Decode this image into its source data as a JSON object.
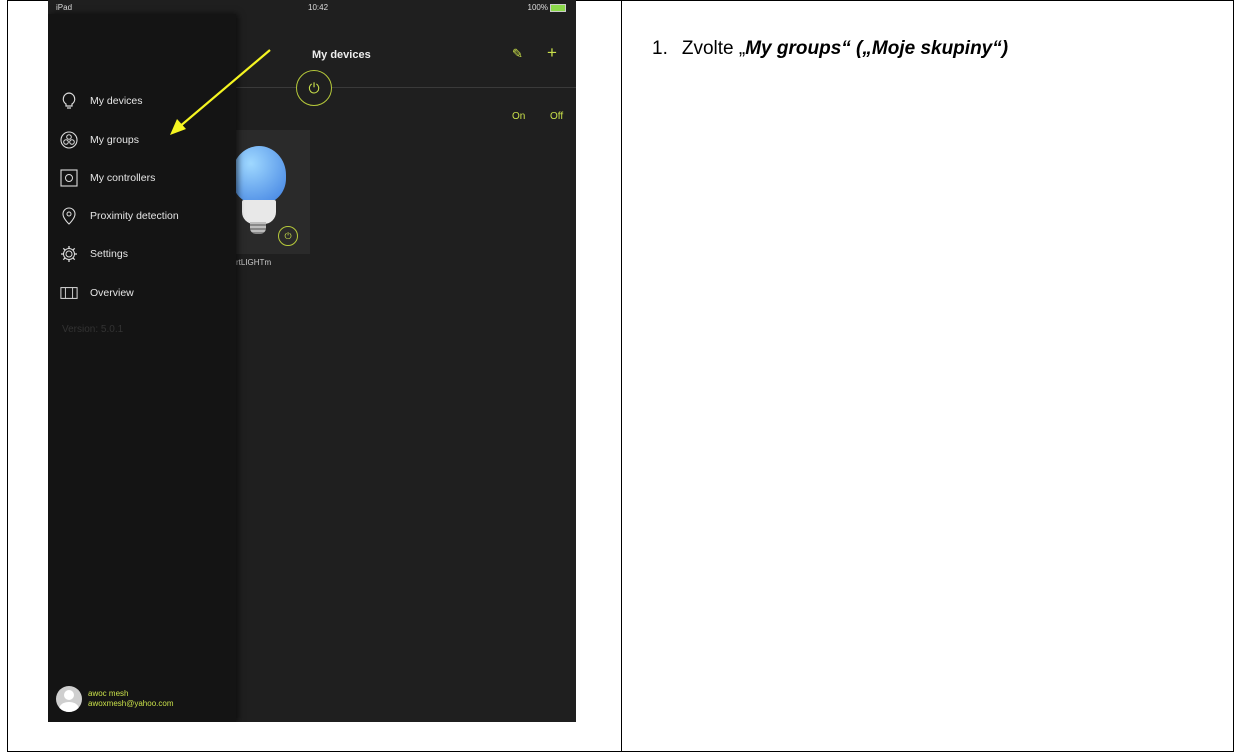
{
  "statusbar": {
    "device": "iPad",
    "time": "10:42",
    "battery": "100%"
  },
  "app": {
    "title": "My devices",
    "on_label": "On",
    "off_label": "Off",
    "device_name": "rtLIGHTm"
  },
  "drawer": {
    "items": [
      {
        "label": "My devices",
        "icon": "bulb-icon"
      },
      {
        "label": "My groups",
        "icon": "groups-icon"
      },
      {
        "label": "My controllers",
        "icon": "controller-icon"
      },
      {
        "label": "Proximity detection",
        "icon": "location-pin-icon"
      },
      {
        "label": "Settings",
        "icon": "gear-icon"
      },
      {
        "label": "Overview",
        "icon": "map-icon"
      }
    ],
    "version": "Version: 5.0.1",
    "user_name": "awoc mesh",
    "user_email": "awoxmesh@yahoo.com"
  },
  "instruction": {
    "number": "1.",
    "prefix": "Zvolte „",
    "bold": "My groups“ („Moje skupiny“)"
  },
  "colors": {
    "accent": "#c9e04a",
    "arrow": "#f5f521"
  }
}
